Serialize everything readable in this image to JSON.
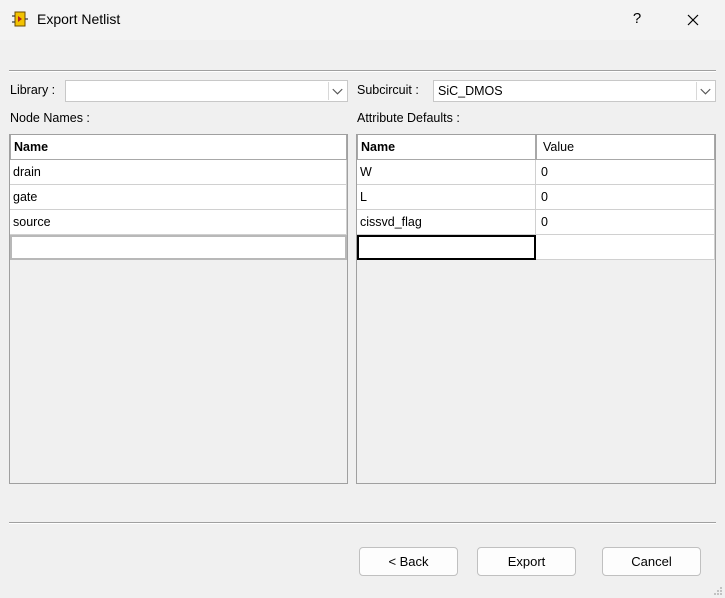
{
  "window": {
    "title": "Export Netlist",
    "help_label": "?",
    "close_icon": "close-icon"
  },
  "library": {
    "label": "Library :",
    "value": ""
  },
  "subcircuit": {
    "label": "Subcircuit :",
    "value": "SiC_DMOS"
  },
  "node_names": {
    "label": "Node Names :",
    "header": "Name",
    "rows": [
      "drain",
      "gate",
      "source",
      ""
    ]
  },
  "attribute_defaults": {
    "label": "Attribute Defaults :",
    "headers": [
      "Name",
      "Value"
    ],
    "rows": [
      {
        "name": "W",
        "value": "0"
      },
      {
        "name": "L",
        "value": "0"
      },
      {
        "name": "cissvd_flag",
        "value": "0"
      },
      {
        "name": "",
        "value": ""
      }
    ]
  },
  "buttons": {
    "back": "< Back",
    "export": "Export",
    "cancel": "Cancel"
  }
}
